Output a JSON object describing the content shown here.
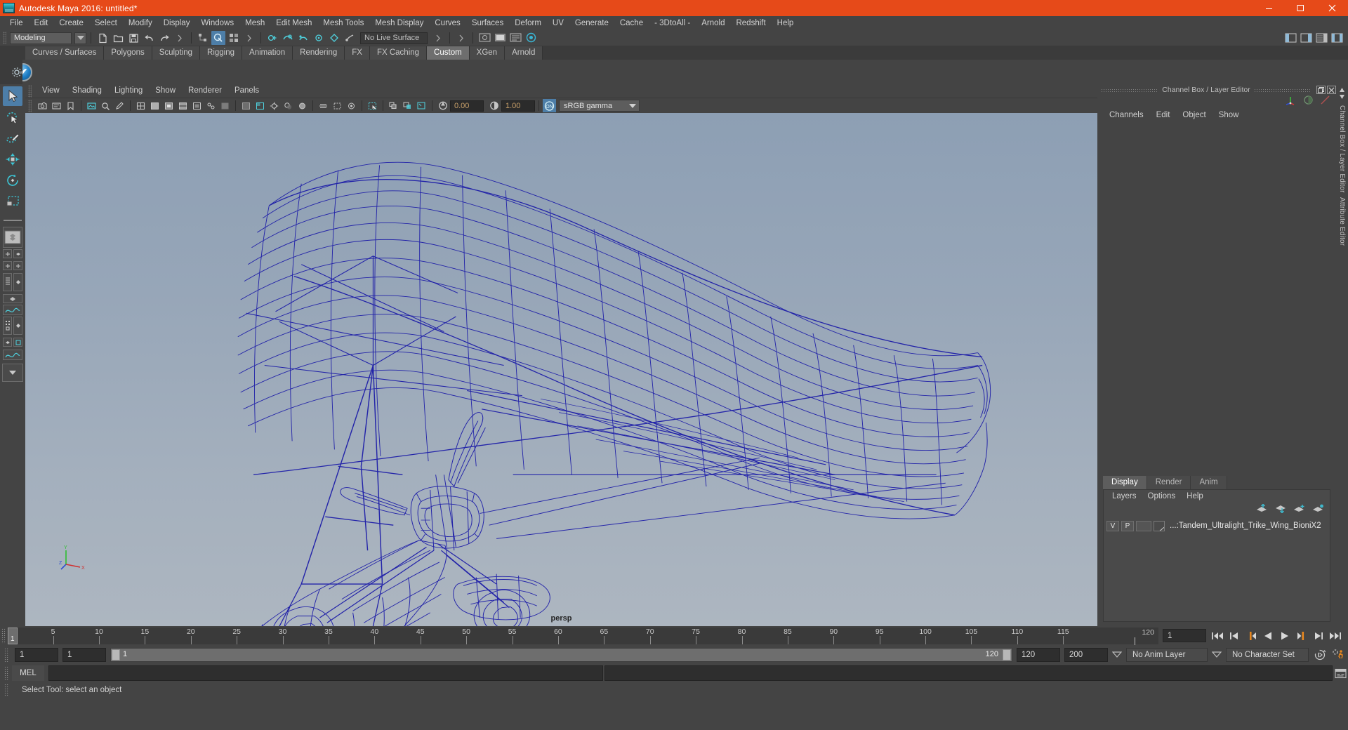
{
  "window": {
    "title": "Autodesk Maya 2016: untitled*",
    "icon": "maya-logo-icon",
    "minimize": "minimize-button",
    "maximize": "maximize-button",
    "close": "close-button"
  },
  "menubar": {
    "items": [
      "File",
      "Edit",
      "Create",
      "Select",
      "Modify",
      "Display",
      "Windows",
      "Mesh",
      "Edit Mesh",
      "Mesh Tools",
      "Mesh Display",
      "Curves",
      "Surfaces",
      "Deform",
      "UV",
      "Generate",
      "Cache",
      "- 3DtoAll -",
      "Arnold",
      "Redshift",
      "Help"
    ]
  },
  "statusbar": {
    "mode": "Modeling",
    "live_surface": "No Live Surface"
  },
  "shelf": {
    "tabs": [
      "Curves / Surfaces",
      "Polygons",
      "Sculpting",
      "Rigging",
      "Animation",
      "Rendering",
      "FX",
      "FX Caching",
      "Custom",
      "XGen",
      "Arnold"
    ],
    "active_tab": "Custom"
  },
  "viewport": {
    "menus": [
      "View",
      "Shading",
      "Lighting",
      "Show",
      "Renderer",
      "Panels"
    ],
    "exposure": "0.00",
    "gamma_value": "1.00",
    "color_management": "sRGB gamma",
    "camera_label": "persp",
    "axis_labels": {
      "y": "Y",
      "x": "X",
      "z": "Z"
    }
  },
  "channel_box": {
    "panel_title": "Channel Box / Layer Editor",
    "menus": [
      "Channels",
      "Edit",
      "Object",
      "Show"
    ]
  },
  "layer_editor": {
    "tabs": [
      "Display",
      "Render",
      "Anim"
    ],
    "active_tab": "Display",
    "menus": [
      "Layers",
      "Options",
      "Help"
    ],
    "layers": [
      {
        "visibility": "V",
        "playback": "P",
        "type": "",
        "name": "...:Tandem_Ultralight_Trike_Wing_BioniX2"
      }
    ]
  },
  "right_edge": {
    "tabs": [
      "Channel Box / Layer Editor",
      "Attribute Editor"
    ]
  },
  "timeline": {
    "current_frame": "1",
    "range_start": "1",
    "range_end": "120",
    "ticks": [
      5,
      10,
      15,
      20,
      25,
      30,
      35,
      40,
      45,
      50,
      55,
      60,
      65,
      70,
      75,
      80,
      85,
      90,
      95,
      100,
      105,
      110,
      115,
      120
    ],
    "playhead_label": "1",
    "end_label": "120"
  },
  "range_slider": {
    "start_field": "1",
    "anim_start": "1",
    "slider_start": "1",
    "slider_end": "120",
    "anim_end": "120",
    "playback_end": "200",
    "anim_layer": "No Anim Layer",
    "character_set": "No Character Set"
  },
  "command_line": {
    "tab_label": "MEL",
    "input_value": ""
  },
  "status_line": {
    "message": "Select Tool: select an object"
  },
  "colors": {
    "title_bar": "#e64a19",
    "app_bg": "#444444",
    "panel_bg": "#3b3b3b",
    "accent_blue": "#4d7ea8",
    "wireframe": "#1d1da8",
    "field_text": "#c8a06a"
  }
}
